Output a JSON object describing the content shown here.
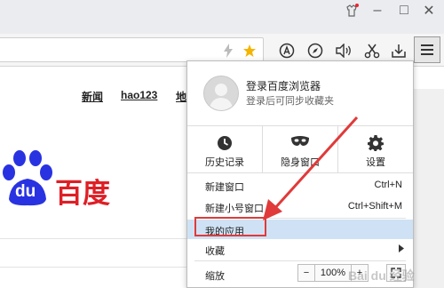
{
  "window": {
    "controls": {
      "min": "–",
      "max": "□",
      "close": "✕"
    }
  },
  "page": {
    "nav_links": [
      "新闻",
      "hao123",
      "地"
    ],
    "logo": {
      "left": "du",
      "right": "百度"
    }
  },
  "menu": {
    "login_title": "登录百度浏览器",
    "login_sub": "登录后可同步收藏夹",
    "quick": [
      {
        "label": "历史记录",
        "icon": "clock-icon"
      },
      {
        "label": "隐身窗口",
        "icon": "mask-icon"
      },
      {
        "label": "设置",
        "icon": "gear-icon"
      }
    ],
    "items": [
      {
        "label": "新建窗口",
        "shortcut": "Ctrl+N"
      },
      {
        "label": "新建小号窗口",
        "shortcut": "Ctrl+Shift+M"
      },
      {
        "label": "我的应用",
        "shortcut": ""
      },
      {
        "label": "收藏",
        "shortcut": ""
      }
    ],
    "zoom": {
      "label": "缩放",
      "minus": "−",
      "value": "100%",
      "plus": "+"
    }
  },
  "watermark": "Bai du 经验",
  "colors": {
    "accent_red": "#de1f26",
    "baidu_blue": "#2932e1",
    "highlight": "#cfe2f5",
    "star": "#f5b400"
  }
}
